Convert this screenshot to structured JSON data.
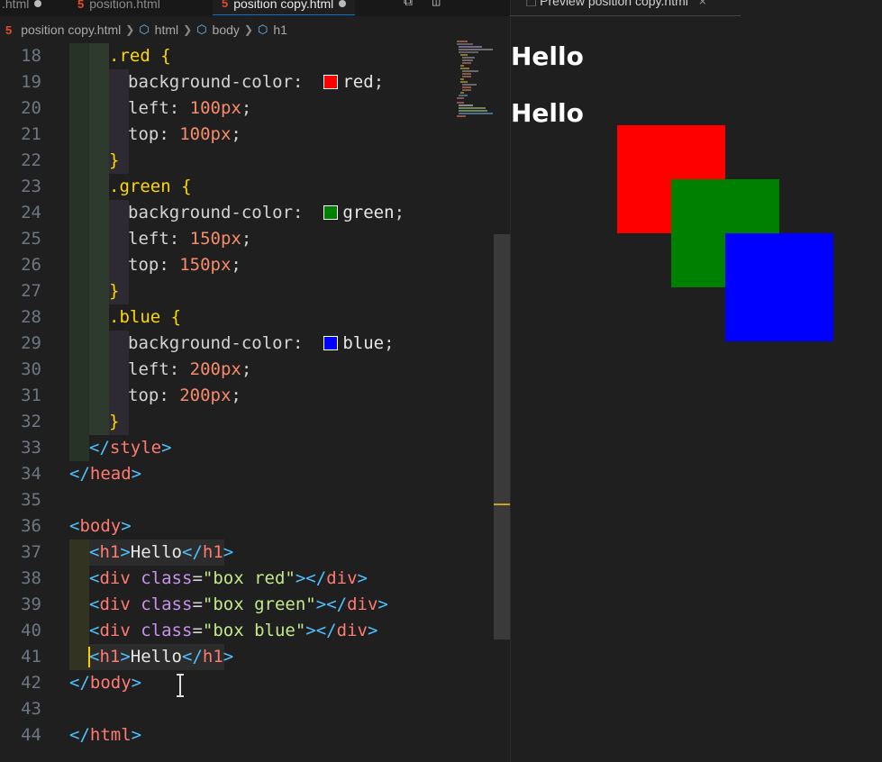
{
  "tabs": [
    {
      "label": ".html",
      "dirty": true
    },
    {
      "label": "position.html"
    },
    {
      "label": "position copy.html",
      "active": true,
      "dirty": true
    }
  ],
  "breadcrumb": [
    "position copy.html",
    "html",
    "body",
    "h1"
  ],
  "preview_tab": {
    "label": "Preview position copy.html",
    "close": "×"
  },
  "colors": {
    "red": "#ff0000",
    "green": "#008000",
    "blue": "#0000ff"
  },
  "icons": [
    "html5-file-icon",
    "chevron-right-icon",
    "cube-symbol-icon",
    "split-editor-icon",
    "open-changes-icon",
    "close-icon"
  ],
  "code": {
    "l18": {
      "n": "18",
      "sel": ".red",
      "brace": "{"
    },
    "l19": {
      "n": "19",
      "prop": "background-color:",
      "val": "red",
      "semi": ";"
    },
    "l20": {
      "n": "20",
      "prop": "left:",
      "val": "100px",
      "semi": ";"
    },
    "l21": {
      "n": "21",
      "prop": "top:",
      "val": "100px",
      "semi": ";"
    },
    "l22": {
      "n": "22",
      "brace": "}"
    },
    "l23": {
      "n": "23",
      "sel": ".green",
      "brace": "{"
    },
    "l24": {
      "n": "24",
      "prop": "background-color:",
      "val": "green",
      "semi": ";"
    },
    "l25": {
      "n": "25",
      "prop": "left:",
      "val": "150px",
      "semi": ";"
    },
    "l26": {
      "n": "26",
      "prop": "top:",
      "val": "150px",
      "semi": ";"
    },
    "l27": {
      "n": "27",
      "brace": "}"
    },
    "l28": {
      "n": "28",
      "sel": ".blue",
      "brace": "{"
    },
    "l29": {
      "n": "29",
      "prop": "background-color:",
      "val": "blue",
      "semi": ";"
    },
    "l30": {
      "n": "30",
      "prop": "left:",
      "val": "200px",
      "semi": ";"
    },
    "l31": {
      "n": "31",
      "prop": "top:",
      "val": "200px",
      "semi": ";"
    },
    "l32": {
      "n": "32",
      "brace": "}"
    },
    "l33": {
      "n": "33",
      "open": "</",
      "tag": "style",
      "close": ">"
    },
    "l34": {
      "n": "34",
      "open": "</",
      "tag": "head",
      "close": ">"
    },
    "l35": {
      "n": "35"
    },
    "l36": {
      "n": "36",
      "open": "<",
      "tag": "body",
      "close": ">"
    },
    "l37": {
      "n": "37",
      "open": "<",
      "tag": "h1",
      "close": ">",
      "text": "Hello",
      "open2": "</",
      "tag2": "h1",
      "close2": ">"
    },
    "l38": {
      "n": "38",
      "open": "<",
      "tag": "div",
      "attr": "class",
      "eq": "=",
      "str": "\"box red\"",
      "close": ">",
      "open2": "</",
      "tag2": "div",
      "close2": ">"
    },
    "l39": {
      "n": "39",
      "open": "<",
      "tag": "div",
      "attr": "class",
      "eq": "=",
      "str": "\"box green\"",
      "close": ">",
      "open2": "</",
      "tag2": "div",
      "close2": ">"
    },
    "l40": {
      "n": "40",
      "open": "<",
      "tag": "div",
      "attr": "class",
      "eq": "=",
      "str": "\"box blue\"",
      "close": ">",
      "open2": "</",
      "tag2": "div",
      "close2": ">"
    },
    "l41": {
      "n": "41",
      "open": "<",
      "tag": "h1",
      "close": ">",
      "text": "Hello",
      "open2": "</",
      "tag2": "h1",
      "close2": ">"
    },
    "l42": {
      "n": "42",
      "open": "</",
      "tag": "body",
      "close": ">"
    },
    "l43": {
      "n": "43"
    },
    "l44": {
      "n": "44",
      "open": "</",
      "tag": "html",
      "close": ">"
    }
  },
  "preview": {
    "heading_1": "Hello",
    "heading_2": "Hello"
  }
}
